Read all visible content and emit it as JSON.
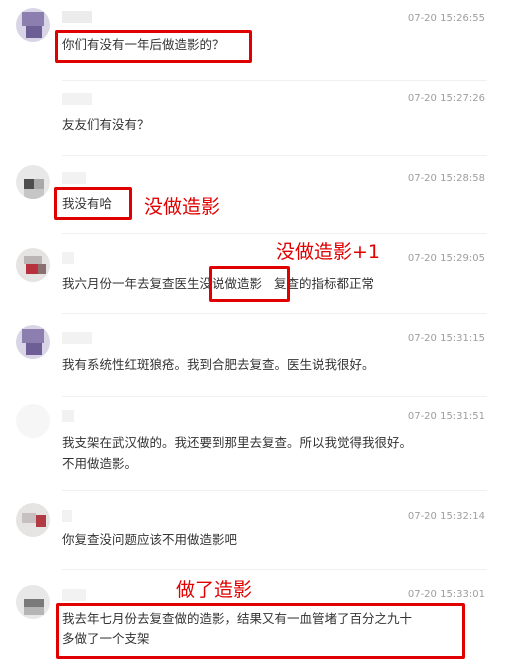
{
  "comments": [
    {
      "time": "07-20 15:26:55",
      "text": "你们有没有一年后做造影的？"
    },
    {
      "time": "07-20 15:27:26",
      "text": "友友们有没有？"
    },
    {
      "time": "07-20 15:28:58",
      "text": "我没有哈"
    },
    {
      "time": "07-20 15:29:05",
      "text_before": "我六月份一年去复查医生",
      "text_highlight": "没说做造影",
      "text_after": "复查的指标都正常"
    },
    {
      "time": "07-20 15:31:15",
      "text": "我有系统性红斑狼疮。我到合肥去复查。医生说我很好。"
    },
    {
      "time": "07-20 15:31:51",
      "line1": "我支架在武汉做的。我还要到那里去复查。所以我觉得我很好。",
      "line2": "不用做造影。"
    },
    {
      "time": "07-20 15:32:14",
      "text": "你复查没问题应该不用做造影吧"
    },
    {
      "time": "07-20 15:33:01",
      "line1": "我去年七月份去复查做的造影，结果又有一血管堵了百分之九十",
      "line2": "多做了一个支架"
    }
  ],
  "annotations": {
    "a1": "没做造影",
    "a2": "没做造影+1",
    "a3": "做了造影"
  },
  "colors": {
    "highlight": "#e10000",
    "timestamp": "#9e9e9e",
    "text": "#333333"
  }
}
